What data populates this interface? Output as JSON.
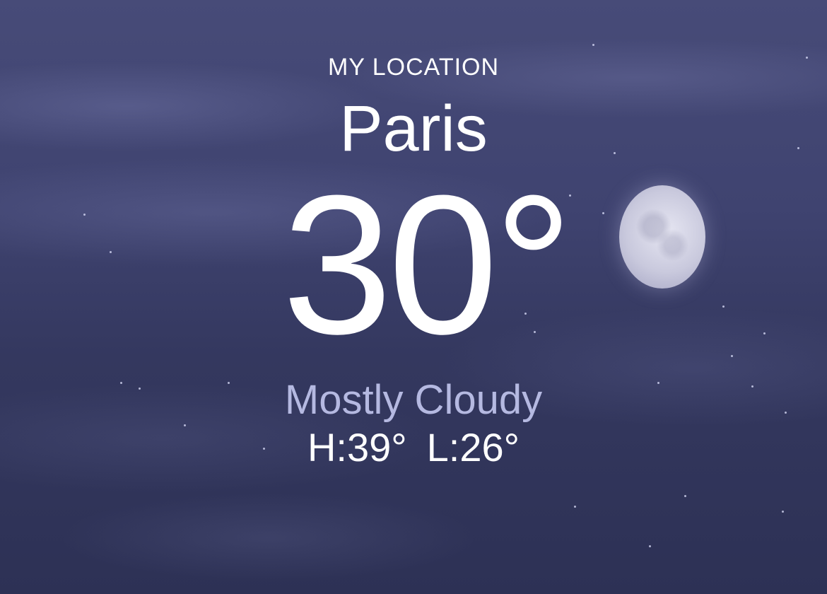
{
  "weather": {
    "location_label": "MY LOCATION",
    "city": "Paris",
    "temperature": "30°",
    "condition": "Mostly Cloudy",
    "high": "H:39°",
    "low": "L:26°"
  },
  "background": {
    "icon": "moon-icon",
    "condition_color": "#b5b9e1",
    "sky_color": "#3f4370"
  }
}
